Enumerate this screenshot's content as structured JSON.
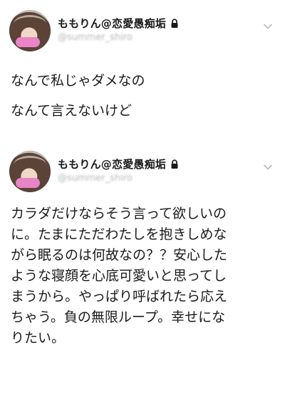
{
  "tweets": [
    {
      "display_name": "ももりん@恋愛愚痴垢",
      "handle": "@summer_shiro",
      "text": "なんで私じゃダメなの\nなんて言えないけど",
      "icons": [
        "lock-icon",
        "chevron-down-icon"
      ]
    },
    {
      "display_name": "ももりん@恋愛愚痴垢",
      "handle": "@summer_shiro",
      "text": "カラダだけならそう言って欲しいの\nに。たまにただわたしを抱きしめな\nがら眠るのは何故なの？？安心した\nような寝顔を心底可愛いと思ってし\nまうから。やっぱり呼ばれたら応え\nちゃう。負の無限ループ。幸せにな\nりたい。",
      "icons": [
        "lock-icon",
        "chevron-down-icon"
      ]
    }
  ],
  "colors": {
    "text": "#1a1a1a",
    "handle": "#b7b7b7",
    "badge": "#e984c7",
    "chevron": "#b8b8b8"
  }
}
